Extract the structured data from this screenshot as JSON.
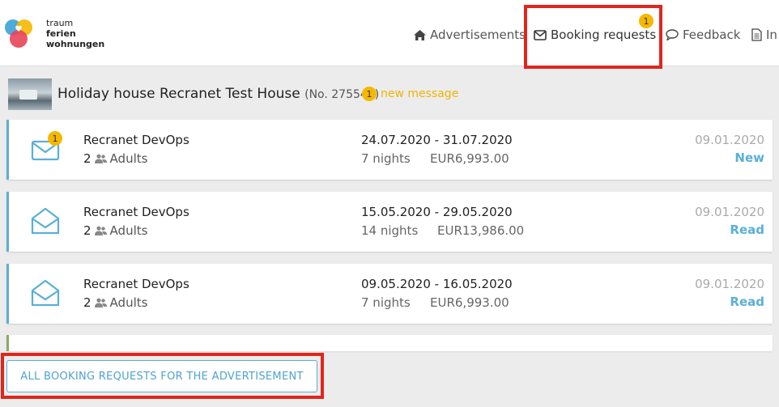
{
  "brand": {
    "line1": "traum",
    "line2": "ferien",
    "line3": "wohnungen"
  },
  "nav": {
    "advertisements": "Advertisements",
    "booking_requests": "Booking requests",
    "booking_badge": "1",
    "feedback": "Feedback",
    "info": "In"
  },
  "house": {
    "title": "Holiday house Recranet Test House",
    "number": "(No. 275545)",
    "badge": "1",
    "new_message": "new message"
  },
  "requests": [
    {
      "name": "Recranet DevOps",
      "guest_count": "2",
      "guest_label": "Adults",
      "dates": "24.07.2020 - 31.07.2020",
      "nights": "7 nights",
      "price": "EUR6,993.00",
      "received": "09.01.2020",
      "status": "New",
      "unread_badge": "1"
    },
    {
      "name": "Recranet DevOps",
      "guest_count": "2",
      "guest_label": "Adults",
      "dates": "15.05.2020 - 29.05.2020",
      "nights": "14 nights",
      "price": "EUR13,986.00",
      "received": "09.01.2020",
      "status": "Read"
    },
    {
      "name": "Recranet DevOps",
      "guest_count": "2",
      "guest_label": "Adults",
      "dates": "09.05.2020 - 16.05.2020",
      "nights": "7 nights",
      "price": "EUR6,993.00",
      "received": "09.01.2020",
      "status": "Read"
    }
  ],
  "all_requests_button": "ALL BOOKING REQUESTS FOR THE ADVERTISEMENT",
  "colors": {
    "accent": "#5aafd8",
    "badge": "#f5b800",
    "highlight": "#e0261c",
    "new_message": "#f0b400"
  },
  "icons": {
    "nav_ads": "home-icon",
    "nav_booking": "envelope-icon",
    "nav_feedback": "speech-bubble-icon",
    "nav_info": "document-icon",
    "guests": "users-icon",
    "unread": "envelope-closed-icon",
    "read": "envelope-open-icon"
  }
}
